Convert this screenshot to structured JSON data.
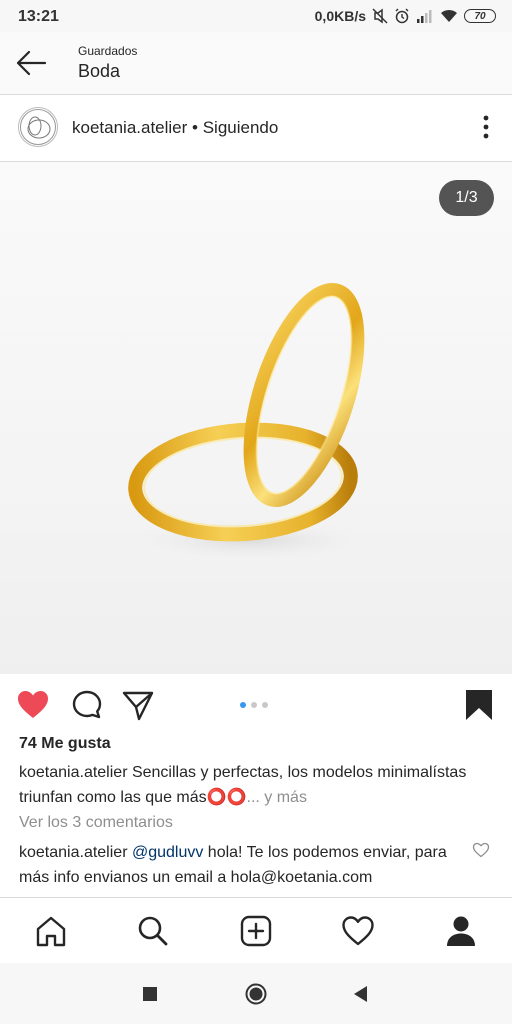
{
  "status_bar": {
    "time": "13:21",
    "network_speed": "0,0KB/s",
    "battery": "70",
    "icons": [
      "mute-icon",
      "alarm-icon",
      "signal-icon",
      "wifi-icon",
      "battery-icon"
    ]
  },
  "header": {
    "subtitle": "Guardados",
    "title": "Boda"
  },
  "post": {
    "username": "koetania.atelier",
    "follow_status": "• Siguiendo",
    "image_counter": "1/3",
    "image_description_colors": {
      "ring_gold": "#e7b32c",
      "background": "#f5f5f5"
    },
    "carousel": {
      "count": 3,
      "active_index": 0
    },
    "likes": "74 Me gusta",
    "caption_user": "koetania.atelier",
    "caption_text": " Sencillas y perfectas, los modelos minimalístas triunfan como las que más⭕⭕",
    "caption_more": "... y más",
    "view_comments": "Ver los 3 comentarios",
    "comment_user": "koetania.atelier",
    "comment_mention": "@gudluvv",
    "comment_text": " hola! Te los podemos enviar, para más info envianos un email  a hola@koetania.com"
  },
  "colors": {
    "like_red": "#ed4956",
    "link_blue": "#3897f0",
    "mention_blue": "#003569",
    "muted_gray": "#8e8e8e"
  },
  "tab_bar": {
    "icons": [
      "home-icon",
      "search-icon",
      "new-post-icon",
      "activity-icon",
      "profile-icon"
    ]
  },
  "nav_bar": {
    "icons": [
      "recents-icon",
      "home-nav-icon",
      "back-nav-icon"
    ]
  }
}
